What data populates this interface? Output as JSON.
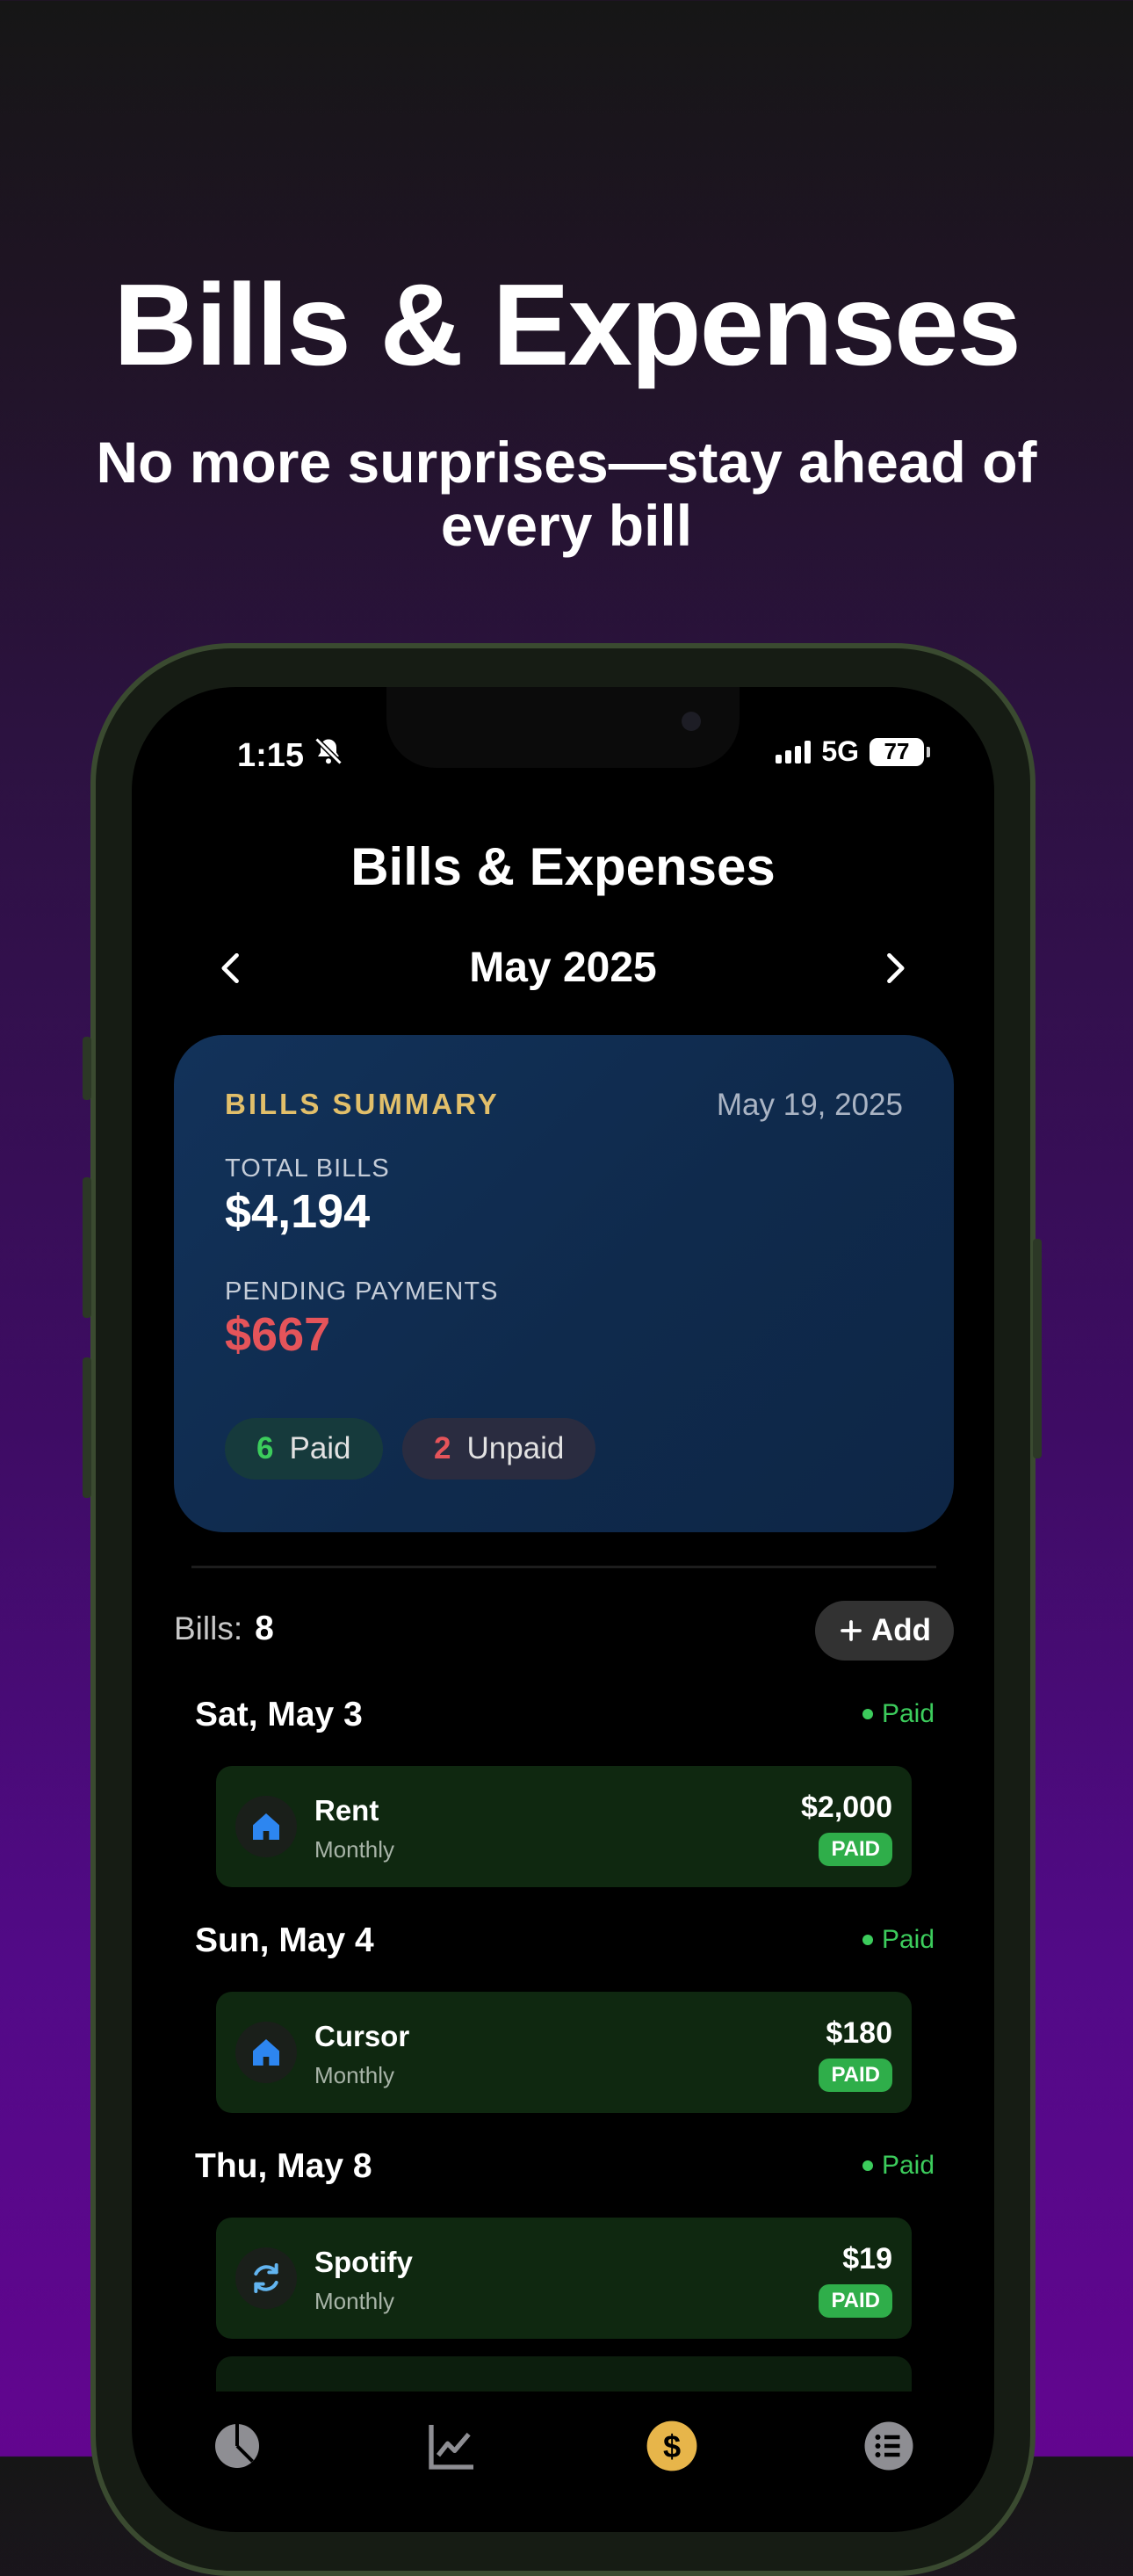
{
  "hero": {
    "title": "Bills & Expenses",
    "subtitle": "No more surprises—stay ahead of every bill"
  },
  "status_bar": {
    "time": "1:15",
    "network": "5G",
    "battery": "77"
  },
  "app": {
    "title": "Bills & Expenses",
    "month": "May 2025"
  },
  "summary": {
    "heading": "BILLS SUMMARY",
    "date": "May 19, 2025",
    "total_label": "TOTAL BILLS",
    "total_value": "$4,194",
    "pending_label": "PENDING PAYMENTS",
    "pending_value": "$667",
    "paid_count": "6",
    "paid_label": "Paid",
    "unpaid_count": "2",
    "unpaid_label": "Unpaid"
  },
  "bills": {
    "count_label": "Bills:",
    "count": "8",
    "add_label": "Add",
    "groups": [
      {
        "day": "Sat, May 3",
        "status": "Paid",
        "name": "Rent",
        "frequency": "Monthly",
        "amount": "$2,000",
        "badge": "PAID",
        "icon": "house-icon"
      },
      {
        "day": "Sun, May 4",
        "status": "Paid",
        "name": "Cursor",
        "frequency": "Monthly",
        "amount": "$180",
        "badge": "PAID",
        "icon": "house-icon"
      },
      {
        "day": "Thu, May 8",
        "status": "Paid",
        "name": "Spotify",
        "frequency": "Monthly",
        "amount": "$19",
        "badge": "PAID",
        "icon": "refresh-icon"
      }
    ]
  },
  "colors": {
    "paid_green": "#3ccc5c",
    "pending_red": "#e5545a",
    "summary_gold": "#e2bf6a",
    "card_blue": "#12325a",
    "add_button_gold": "#e7b54a"
  },
  "tab_icons": [
    "pie-chart-icon",
    "trend-chart-icon",
    "dollar-coin-icon",
    "list-icon"
  ]
}
